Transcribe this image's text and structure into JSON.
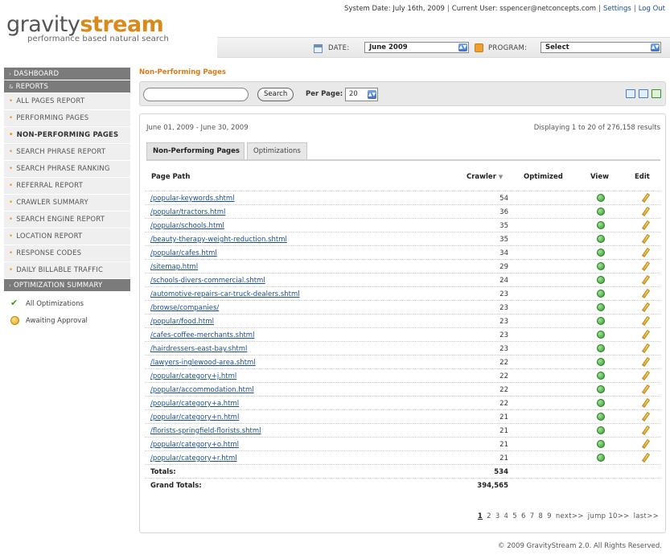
{
  "brand": {
    "name_part1": "gravity",
    "name_part2": "stream",
    "tagline": "performance based natural search",
    "accent_color": "#d98a1c"
  },
  "topbar": {
    "system_date": "System Date: July 16th, 2009",
    "current_user": "Current User: sspencer@netconcepts.com",
    "settings_label": "Settings",
    "logout_label": "Log Out"
  },
  "filters": {
    "date_label": "DATE:",
    "date_value": "June 2009",
    "program_label": "PROGRAM:",
    "program_value": "Select"
  },
  "sidebar": {
    "dashboard": "DASHBOARD",
    "reports": "REPORTS",
    "items": [
      {
        "label": "ALL PAGES REPORT"
      },
      {
        "label": "PERFORMING PAGES"
      },
      {
        "label": "NON-PERFORMING PAGES"
      },
      {
        "label": "SEARCH PHRASE REPORT"
      },
      {
        "label": "SEARCH PHRASE RANKING"
      },
      {
        "label": "REFERRAL REPORT"
      },
      {
        "label": "CRAWLER SUMMARY"
      },
      {
        "label": "SEARCH ENGINE REPORT"
      },
      {
        "label": "LOCATION REPORT"
      },
      {
        "label": "RESPONSE CODES"
      },
      {
        "label": "DAILY BILLABLE TRAFFIC"
      }
    ],
    "optimization_summary": "OPTIMIZATION SUMMARY",
    "sub_items": [
      {
        "label": "All Optimizations",
        "icon": "check-icon"
      },
      {
        "label": "Awaiting Approval",
        "icon": "coin-icon"
      }
    ]
  },
  "main": {
    "breadcrumb": "Non-Performing Pages",
    "search_placeholder": "",
    "search_button": "Search",
    "per_page_label": "Per Page:",
    "per_page_value": "20",
    "date_range": "June 01, 2009 - June 30, 2009",
    "displaying": "Displaying 1 to 20 of 276,158 results",
    "tabs": [
      {
        "label": "Non-Performing Pages"
      },
      {
        "label": "Optimizations"
      }
    ],
    "columns": {
      "page_path": "Page Path",
      "crawler": "Crawler",
      "optimized": "Optimized",
      "view": "View",
      "edit": "Edit"
    },
    "rows": [
      {
        "path": "/popular-keywords.shtml",
        "crawler": "54"
      },
      {
        "path": "/popular/tractors.html",
        "crawler": "36"
      },
      {
        "path": "/popular/schools.html",
        "crawler": "35"
      },
      {
        "path": "/beauty-therapy-weight-reduction.shtml",
        "crawler": "35"
      },
      {
        "path": "/popular/cafes.html",
        "crawler": "34"
      },
      {
        "path": "/sitemap.html",
        "crawler": "29"
      },
      {
        "path": "/schools-divers-commercial.shtml",
        "crawler": "24"
      },
      {
        "path": "/automotive-repairs-car-truck-dealers.shtml",
        "crawler": "23"
      },
      {
        "path": "/browse/companies/",
        "crawler": "23"
      },
      {
        "path": "/popular/food.html",
        "crawler": "23"
      },
      {
        "path": "/cafes-coffee-merchants.shtml",
        "crawler": "23"
      },
      {
        "path": "/hairdressers-east-bay.shtml",
        "crawler": "23"
      },
      {
        "path": "/lawyers-inglewood-area.shtml",
        "crawler": "22"
      },
      {
        "path": "/popular/category+j.html",
        "crawler": "22"
      },
      {
        "path": "/popular/accommodation.html",
        "crawler": "22"
      },
      {
        "path": "/popular/category+a.html",
        "crawler": "22"
      },
      {
        "path": "/popular/category+n.html",
        "crawler": "21"
      },
      {
        "path": "/florists-springfield-florists.shtml",
        "crawler": "21"
      },
      {
        "path": "/popular/category+o.html",
        "crawler": "21"
      },
      {
        "path": "/popular/category+r.html",
        "crawler": "21"
      }
    ],
    "totals_label": "Totals:",
    "totals_value": "534",
    "grand_totals_label": "Grand Totals:",
    "grand_totals_value": "394,565",
    "pager": {
      "pages": [
        "1",
        "2",
        "3",
        "4",
        "5",
        "6",
        "7",
        "8",
        "9"
      ],
      "next": "next>>",
      "jump": "jump 10>>",
      "last": "last>>"
    }
  },
  "footer": "© 2009 GravityStream 2.0. All Rights Reserved."
}
